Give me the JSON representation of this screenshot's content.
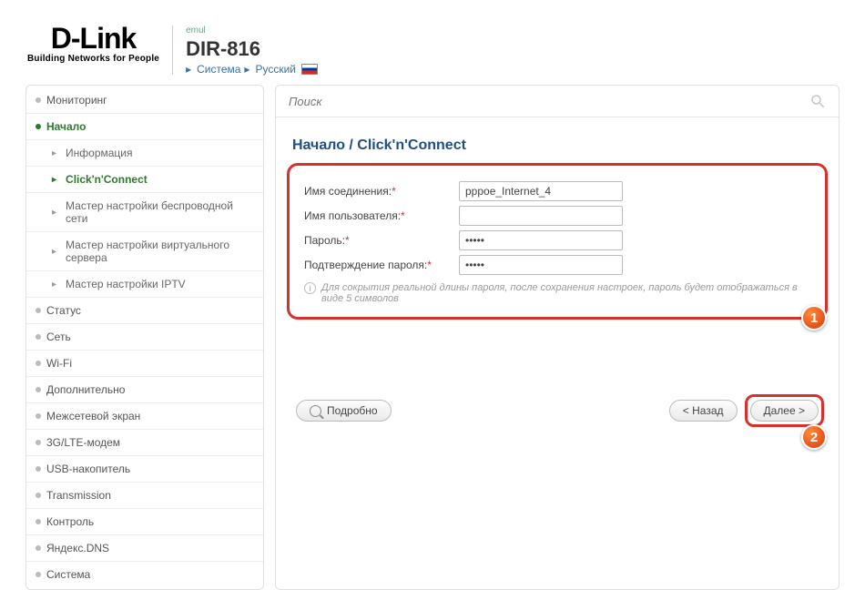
{
  "header": {
    "logo_main": "D-Link",
    "logo_sub": "Building Networks for People",
    "emul": "emul",
    "model": "DIR-816",
    "crumb_system": "Система",
    "crumb_lang": "Русский"
  },
  "sidebar": {
    "items": [
      {
        "label": "Мониторинг"
      },
      {
        "label": "Начало"
      },
      {
        "label": "Статус"
      },
      {
        "label": "Сеть"
      },
      {
        "label": "Wi-Fi"
      },
      {
        "label": "Дополнительно"
      },
      {
        "label": "Межсетевой экран"
      },
      {
        "label": "3G/LTE-модем"
      },
      {
        "label": "USB-накопитель"
      },
      {
        "label": "Transmission"
      },
      {
        "label": "Контроль"
      },
      {
        "label": "Яндекс.DNS"
      },
      {
        "label": "Система"
      }
    ],
    "sub": {
      "info": "Информация",
      "cnc": "Click'n'Connect",
      "wifi": "Мастер настройки беспроводной сети",
      "vs": "Мастер настройки виртуального сервера",
      "iptv": "Мастер настройки IPTV"
    }
  },
  "search": {
    "placeholder": "Поиск"
  },
  "page": {
    "title": "Начало  /  Click'n'Connect"
  },
  "form": {
    "conn_label": "Имя соединения:",
    "conn_value": "pppoe_Internet_4",
    "user_label": "Имя пользователя:",
    "user_value": "",
    "pass_label": "Пароль:",
    "pass_value": "•••••",
    "confirm_label": "Подтверждение пароля:",
    "confirm_value": "•••••",
    "hint": "Для сокрытия реальной длины пароля, после сохранения настроек, пароль будет отображаться в виде 5 символов"
  },
  "buttons": {
    "details": "Подробно",
    "back": "< Назад",
    "next": "Далее >"
  },
  "callouts": {
    "one": "1",
    "two": "2"
  }
}
